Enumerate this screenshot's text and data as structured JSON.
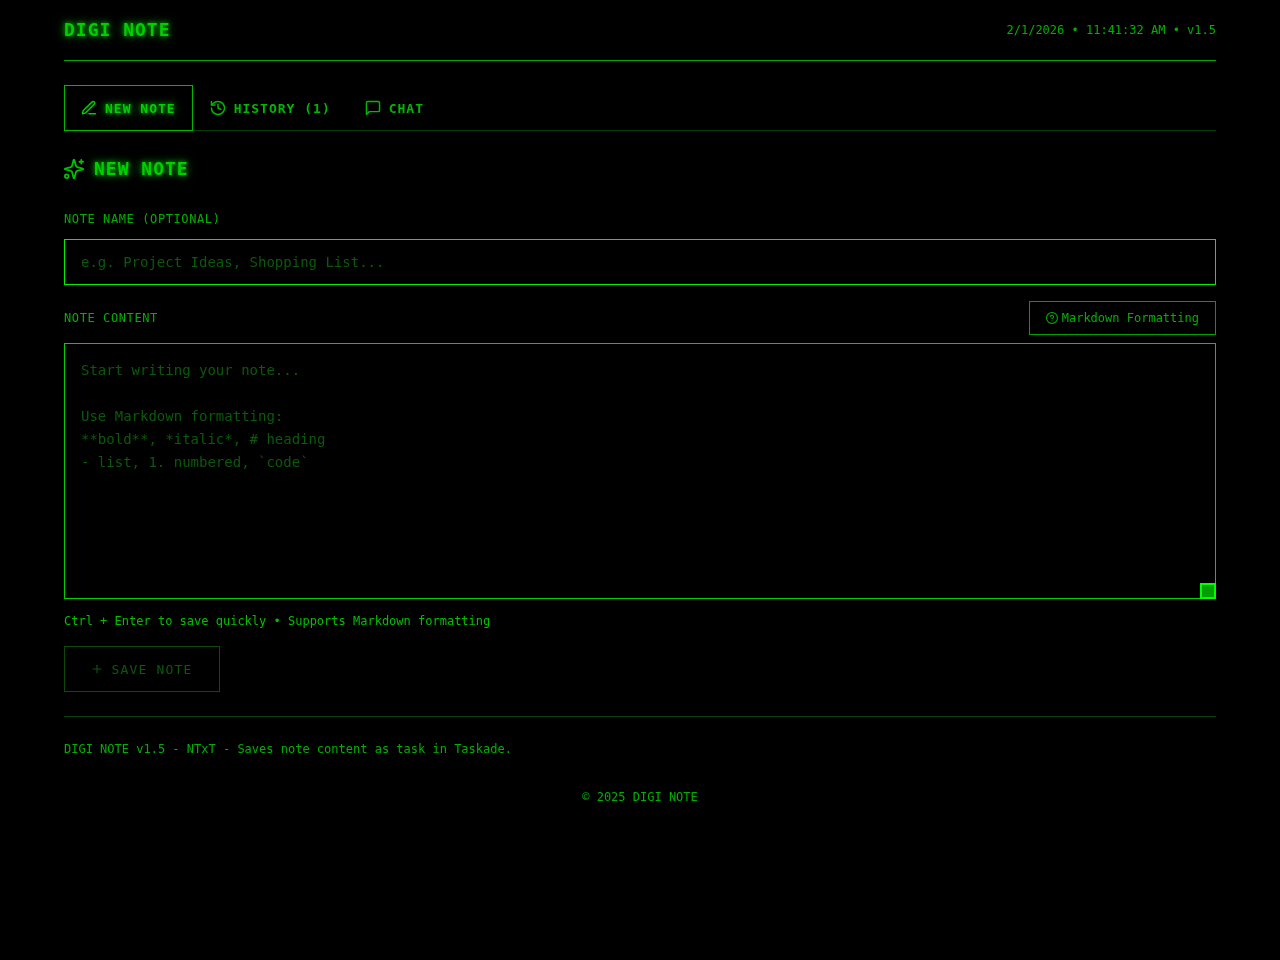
{
  "header": {
    "logo": "DIGI NOTE",
    "status": "2/1/2026 • 11:41:32 AM • v1.5"
  },
  "tabs": [
    {
      "label": "NEW NOTE",
      "selected": true
    },
    {
      "label": "HISTORY (1)",
      "selected": false
    },
    {
      "label": "CHAT",
      "selected": false
    }
  ],
  "section": {
    "title": "NEW NOTE"
  },
  "name_field": {
    "label": "NOTE NAME (OPTIONAL)",
    "placeholder": "e.g. Project Ideas, Shopping List..."
  },
  "content_field": {
    "label": "NOTE CONTENT",
    "help_button": "Markdown Formatting",
    "placeholder": "Start writing your note...\n\nUse Markdown formatting:\n**bold**, *italic*, # heading\n- list, 1. numbered, `code`"
  },
  "hint": "Ctrl + Enter to save quickly • Supports Markdown formatting",
  "save_button": {
    "label": "SAVE NOTE",
    "disabled": true
  },
  "footer": {
    "text": "DIGI NOTE v1.5 - NTxT - Saves note content as task in Taskade.",
    "copyright": "© 2025 DIGI NOTE"
  }
}
